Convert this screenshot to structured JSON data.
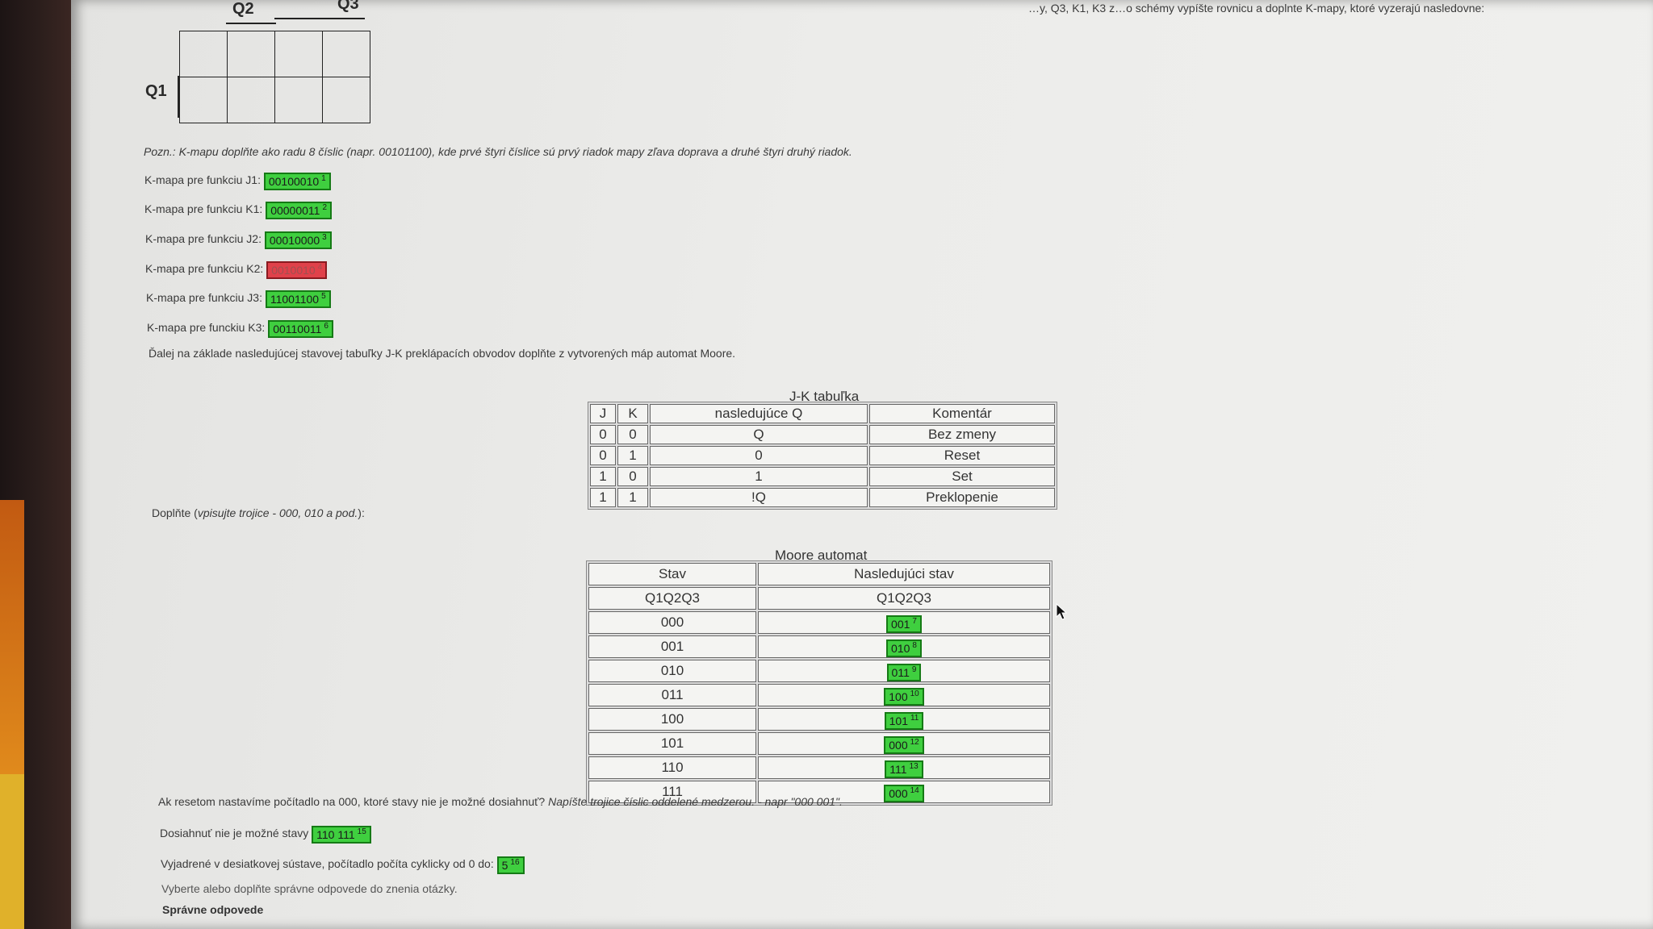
{
  "kmap": {
    "col_labels": [
      "Q2",
      "Q3"
    ],
    "row_label": "Q1"
  },
  "top_instruction": "…y, Q3, K1, K3 z…o schémy vypíšte rovnicu a doplnte K-mapy, ktoré vyzerajú nasledovne:",
  "note": "Pozn.: K-mapu doplňte ako radu 8 číslic (napr. 00101100), kde prvé štyri číslice sú prvý riadok mapy zľava doprava a druhé štyri druhý riadok.",
  "kmap_answers": [
    {
      "label": "K-mapa pre funkciu J1:",
      "value": "00100010",
      "num": "1",
      "status": "correct"
    },
    {
      "label": "K-mapa pre funkciu K1:",
      "value": "00000011",
      "num": "2",
      "status": "correct"
    },
    {
      "label": "K-mapa pre funkciu J2:",
      "value": "00010000",
      "num": "3",
      "status": "correct"
    },
    {
      "label": "K-mapa pre funkciu K2:",
      "value": "0010010",
      "num": "4",
      "status": "wrong"
    },
    {
      "label": "K-mapa pre funkciu J3:",
      "value": "11001100",
      "num": "5",
      "status": "correct"
    },
    {
      "label": "K-mapa pre funckiu K3:",
      "value": "00110011",
      "num": "6",
      "status": "correct"
    }
  ],
  "next_instruction": "Ďalej na základe nasledujúcej stavovej tabuľky J-K preklápacích obvodov doplňte z vytvorených máp automat Moore.",
  "fill_hint_prefix": "Doplňte (",
  "fill_hint_italic": "vpisujte trojice - 000, 010 a pod.",
  "fill_hint_suffix": "):",
  "jk_table": {
    "caption": "J-K tabuľka",
    "headers": [
      "J",
      "K",
      "nasledujúce Q",
      "Komentár"
    ],
    "rows": [
      [
        "0",
        "0",
        "Q",
        "Bez zmeny"
      ],
      [
        "0",
        "1",
        "0",
        "Reset"
      ],
      [
        "1",
        "0",
        "1",
        "Set"
      ],
      [
        "1",
        "1",
        "!Q",
        "Preklopenie"
      ]
    ]
  },
  "moore_table": {
    "caption": "Moore automat",
    "headers": [
      "Stav",
      "Nasledujúci stav"
    ],
    "subheaders": [
      "Q1Q2Q3",
      "Q1Q2Q3"
    ],
    "rows": [
      {
        "state": "000",
        "next": "001",
        "num": "7"
      },
      {
        "state": "001",
        "next": "010",
        "num": "8"
      },
      {
        "state": "010",
        "next": "011",
        "num": "9"
      },
      {
        "state": "011",
        "next": "100",
        "num": "10"
      },
      {
        "state": "100",
        "next": "101",
        "num": "11"
      },
      {
        "state": "101",
        "next": "000",
        "num": "12"
      },
      {
        "state": "110",
        "next": "111",
        "num": "13"
      },
      {
        "state": "111",
        "next": "000",
        "num": "14"
      }
    ]
  },
  "q_unreachable": "Ak resetom nastavíme počítadlo na 000, ktoré stavy nie je možné dosiahnuť?",
  "q_unreachable_hint": "Napíšte trojice číslic oddelené medzerou. - napr \"000 001\".",
  "unreachable_label": "Dosiahnuť nie je možné stavy",
  "unreachable_value": "110 111",
  "unreachable_num": "15",
  "decimal_label": "Vyjadrené v desiatkovej sústave, počítadlo počíta cyklicky od 0 do:",
  "decimal_value": "5",
  "decimal_num": "16",
  "select_prompt": "Vyberte alebo doplňte správne odpovede do znenia otázky.",
  "correct_answers_heading": "Správne odpovede",
  "colors": {
    "correct": "#3fcf3f",
    "wrong": "#e0414a"
  }
}
